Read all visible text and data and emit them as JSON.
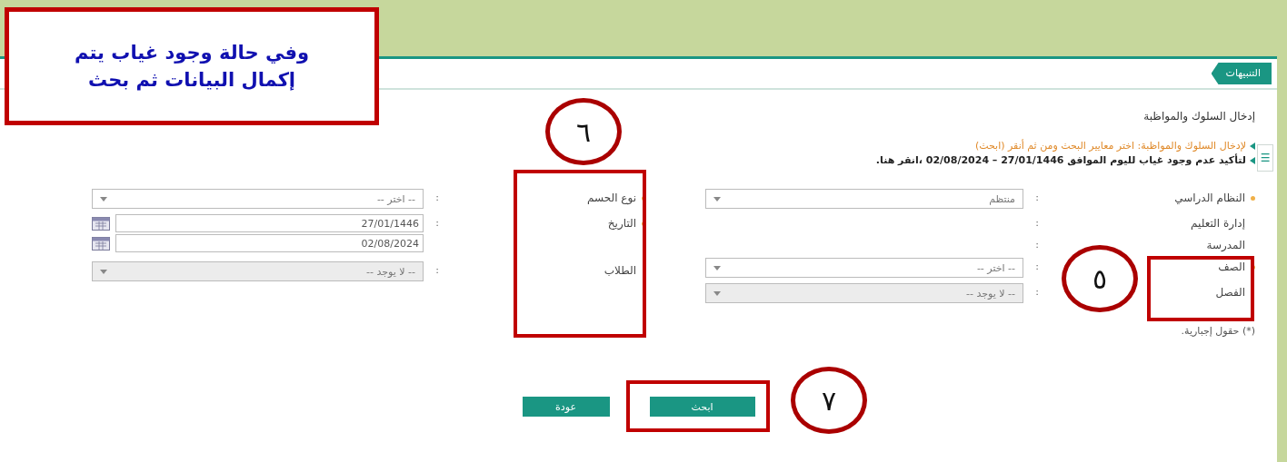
{
  "tab": {
    "label": "التنبيهات"
  },
  "side_toggle": {
    "label": "☰"
  },
  "page_title": "إدخال السلوك والمواظبة",
  "instructions": [
    {
      "kind": "hint",
      "text": "لإدخال السلوك والمواظبة: اختر معايير البحث ومن ثم أنقر (ابحث)"
    },
    {
      "kind": "note",
      "text": "لتأكيد عدم وجود غياب لليوم الموافق 27/01/1446 – 02/08/2024 ،انقر هنا."
    }
  ],
  "form_right": [
    {
      "label": "النظام الدراسي",
      "required": true,
      "colon": ":",
      "kind": "select",
      "value": "منتظم",
      "disabled": false
    },
    {
      "label": "إدارة التعليم",
      "required": false,
      "colon": ":",
      "kind": "text"
    },
    {
      "label": "المدرسة",
      "required": false,
      "colon": ":",
      "kind": "text"
    },
    {
      "label": "الصف",
      "required": true,
      "colon": ":",
      "kind": "select",
      "value": "-- اختر --",
      "disabled": false
    },
    {
      "label": "الفصل",
      "required": false,
      "colon": ":",
      "kind": "select",
      "value": "-- لا يوجد --",
      "disabled": true
    }
  ],
  "form_left": [
    {
      "label": "نوع الحسم",
      "required": true,
      "colon": ":",
      "kind": "select",
      "value": "-- اختر --",
      "disabled": false
    },
    {
      "label": "التاريخ",
      "required": true,
      "colon": ":",
      "kind": "dates",
      "values": [
        "27/01/1446",
        "02/08/2024"
      ]
    },
    {
      "label": "الطلاب",
      "required": false,
      "colon": ":",
      "kind": "select",
      "value": "-- لا يوجد --",
      "disabled": true
    }
  ],
  "required_note": "(*) حقول إجبارية.",
  "buttons": [
    {
      "label": "ابحث"
    },
    {
      "label": "عودة"
    }
  ],
  "callout": {
    "lines": [
      "وفي حالة وجود غياب يتم",
      "إكمال البيانات ثم بحث"
    ]
  },
  "markers": [
    {
      "number": "٦"
    },
    {
      "number": "٥"
    },
    {
      "number": "٧"
    }
  ]
}
